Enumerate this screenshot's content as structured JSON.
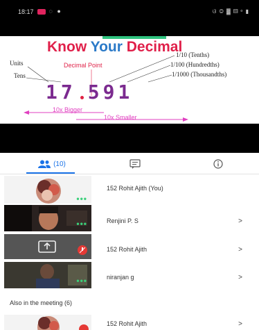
{
  "status_bar": {
    "time": "18:17",
    "right_icons": "ଓ ◎ ▓ ▨ ᵒ ▮"
  },
  "slide": {
    "title_part1": "Know ",
    "title_part2": "Your",
    "title_part3": " Decimal",
    "labels": {
      "units": "Units",
      "tens": "Tens",
      "decimal_point": "Decimal Point",
      "tenths": "1/10 (Tenths)",
      "hundredths": "1/100 (Hundredths)",
      "thousandths": "1/1000 (Thousandths)",
      "bigger": "10x Bigger",
      "smaller": "10x Smaller"
    },
    "number_int": "17",
    "number_frac": "591"
  },
  "tabs": {
    "people_count": "(10)",
    "chat_icon": "message-icon",
    "info_icon": "info-icon"
  },
  "participants": [
    {
      "name": "152 Rohit Ajith (You)",
      "has_chevron": false
    },
    {
      "name": "Renjini P. S",
      "has_chevron": true
    },
    {
      "name": "152 Rohit Ajith",
      "has_chevron": true
    },
    {
      "name": "niranjan g",
      "has_chevron": true
    }
  ],
  "also_section_label": "Also in the meeting (6)",
  "also_participants": [
    {
      "name": "152 Rohit Ajith",
      "has_chevron": true
    }
  ],
  "chevron": ">",
  "colors": {
    "accent": "#1a73e8",
    "title_red": "#e0204a",
    "title_blue": "#2b7ac8",
    "number_purple": "#7b2a8f",
    "mute_red": "#e53935",
    "active_green": "#3ad07a"
  }
}
